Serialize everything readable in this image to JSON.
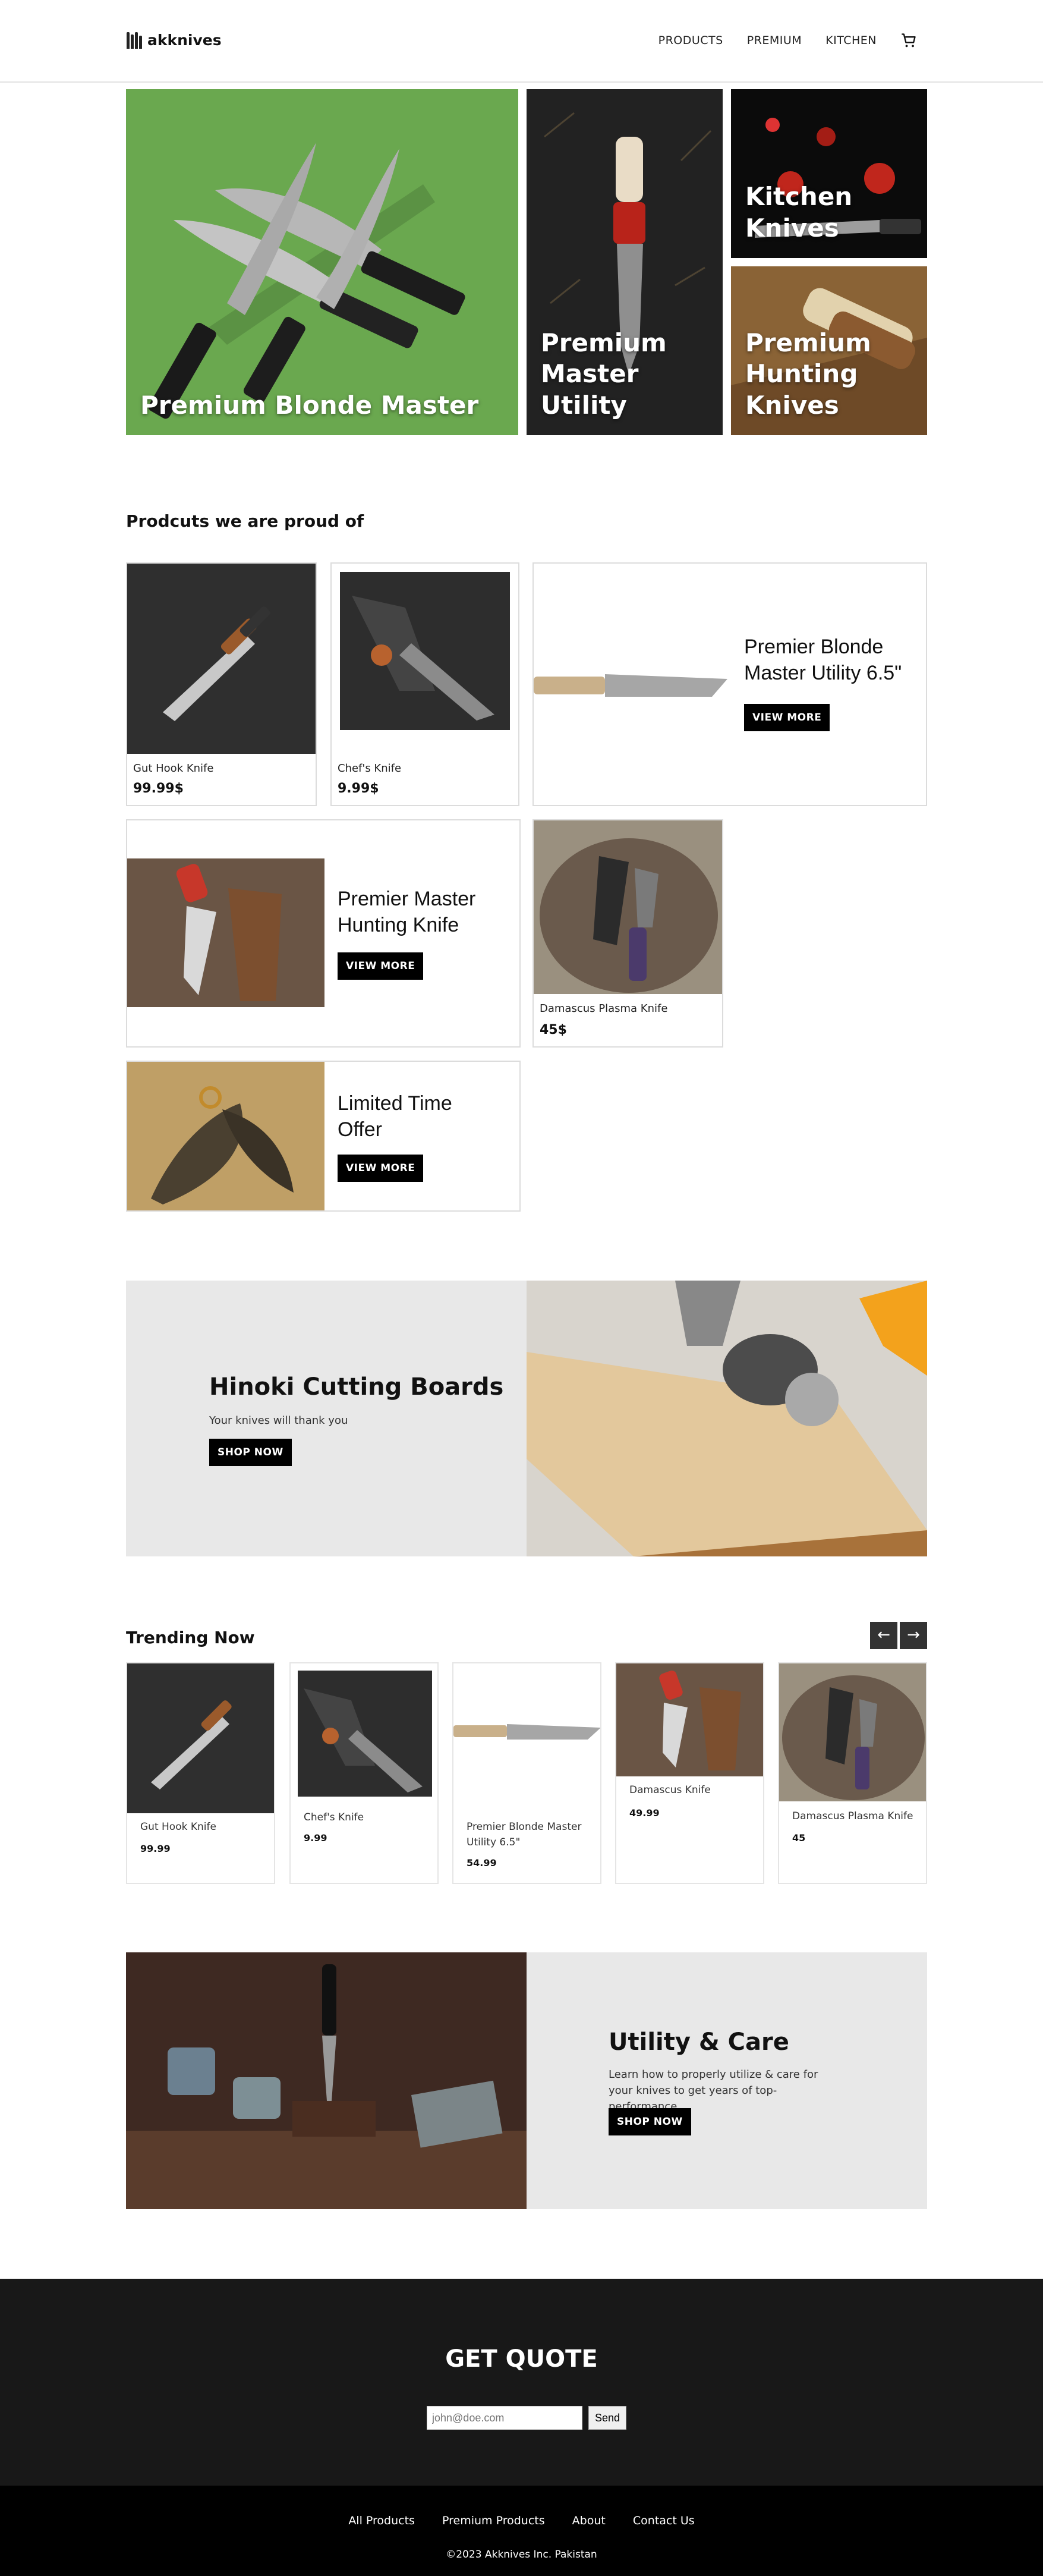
{
  "header": {
    "brand": "akknives",
    "nav": [
      "PRODUCTS",
      "PREMIUM",
      "KITCHEN"
    ],
    "cart_icon": "cart-icon"
  },
  "hero": {
    "tiles": [
      {
        "label": "Premium Blonde Master"
      },
      {
        "label": "Premium Master Utility"
      },
      {
        "label": "Kitchen Knives"
      },
      {
        "label": "Premium Hunting Knives"
      }
    ]
  },
  "proud": {
    "title": "Prodcuts we are proud of",
    "products": [
      {
        "name": "Gut Hook Knife",
        "price": "99.99$"
      },
      {
        "name": "Chef's Knife",
        "price": "9.99$"
      },
      {
        "name": "Damascus Plasma Knife",
        "price": "45$"
      }
    ],
    "features": [
      {
        "title": "Premier Blonde Master Utility 6.5\"",
        "button": "VIEW MORE"
      },
      {
        "title": "Premier Master Hunting Knife",
        "button": "VIEW MORE"
      },
      {
        "title": "Limited Time Offer",
        "button": "VIEW MORE"
      }
    ]
  },
  "hinoki": {
    "title": "Hinoki Cutting Boards",
    "subtitle": "Your knives will thank you",
    "button": "SHOP NOW"
  },
  "trending": {
    "title": "Trending Now",
    "prev": "←",
    "next": "→",
    "items": [
      {
        "name": "Gut Hook Knife",
        "price": "99.99"
      },
      {
        "name": "Chef's Knife",
        "price": "9.99"
      },
      {
        "name": "Premier Blonde Master Utility 6.5\"",
        "price": "54.99"
      },
      {
        "name": "Damascus Knife",
        "price": "49.99"
      },
      {
        "name": "Damascus Plasma Knife",
        "price": "45"
      }
    ]
  },
  "care": {
    "title": "Utility & Care",
    "subtitle": "Learn how to properly utilize & care for your knives to get years of top-performance.",
    "button": "SHOP NOW"
  },
  "quote": {
    "title": "GET QUOTE",
    "email_placeholder": "john@doe.com",
    "send": "Send"
  },
  "footer": {
    "links": [
      "All Products",
      "Premium Products",
      "About",
      "Contact Us"
    ],
    "copyright": "©2023 Akknives Inc. Pakistan"
  },
  "colors": {
    "hero_green": "#6aa84f",
    "banner_gray": "#e8e8e8",
    "quote_bg": "#181818",
    "footer_bg": "#000000"
  }
}
